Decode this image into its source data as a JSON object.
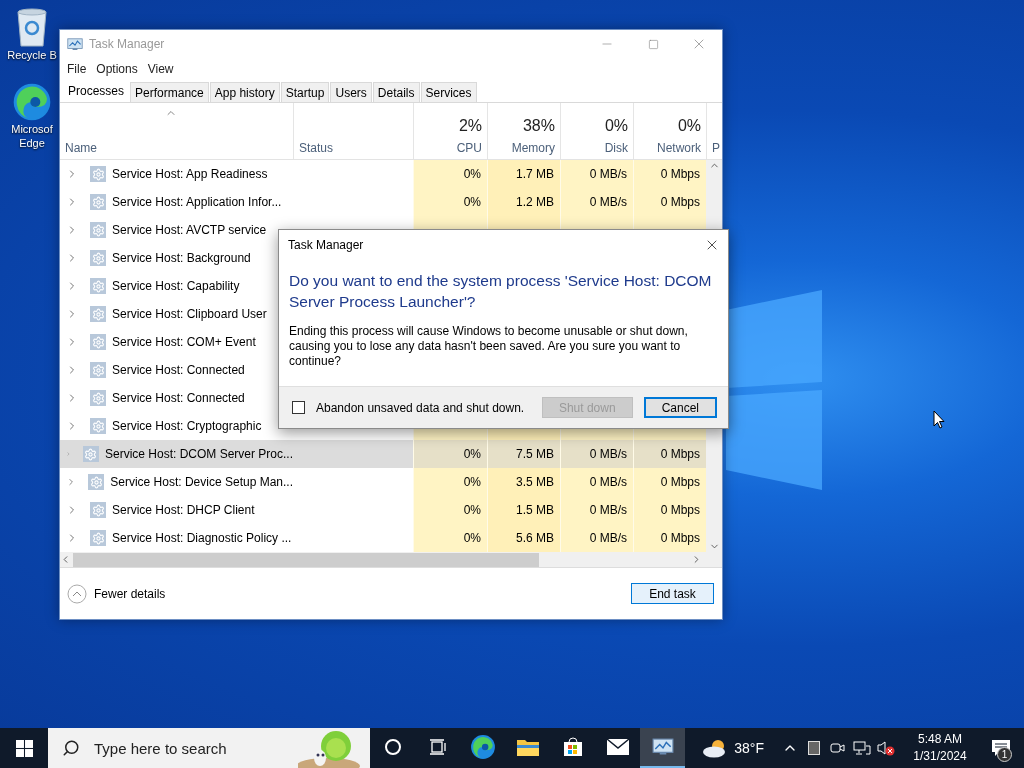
{
  "desktop": {
    "icons": [
      {
        "kind": "recycle",
        "lines": [
          "Recycle B"
        ]
      },
      {
        "kind": "edge",
        "lines": [
          "Microsof",
          "Edge"
        ]
      }
    ]
  },
  "task_manager": {
    "title": "Task Manager",
    "menu": [
      "File",
      "Options",
      "View"
    ],
    "tabs": [
      {
        "label": "Processes",
        "selected": true
      },
      {
        "label": "Performance",
        "selected": false
      },
      {
        "label": "App history",
        "selected": false
      },
      {
        "label": "Startup",
        "selected": false
      },
      {
        "label": "Users",
        "selected": false
      },
      {
        "label": "Details",
        "selected": false
      },
      {
        "label": "Services",
        "selected": false
      }
    ],
    "columns": [
      {
        "label": "Name"
      },
      {
        "label": "Status"
      },
      {
        "percent": "2%",
        "label": "CPU"
      },
      {
        "percent": "38%",
        "label": "Memory"
      },
      {
        "percent": "0%",
        "label": "Disk"
      },
      {
        "percent": "0%",
        "label": "Network"
      },
      {
        "label": "P"
      }
    ],
    "rows": [
      {
        "name": "Service Host: App Readiness",
        "selected": false,
        "cpu": "0%",
        "memory": "1.7 MB",
        "disk": "0 MB/s",
        "network": "0 Mbps"
      },
      {
        "name": "Service Host: Application Infor...",
        "selected": false,
        "cpu": "0%",
        "memory": "1.2 MB",
        "disk": "0 MB/s",
        "network": "0 Mbps"
      },
      {
        "name": "Service Host: AVCTP service",
        "selected": false
      },
      {
        "name": "Service Host: Background",
        "selected": false
      },
      {
        "name": "Service Host: Capability",
        "selected": false
      },
      {
        "name": "Service Host: Clipboard User",
        "selected": false
      },
      {
        "name": "Service Host: COM+ Event",
        "selected": false
      },
      {
        "name": "Service Host: Connected",
        "selected": false
      },
      {
        "name": "Service Host: Connected",
        "selected": false
      },
      {
        "name": "Service Host: Cryptographic",
        "selected": false
      },
      {
        "name": "Service Host: DCOM Server Proc...",
        "selected": true,
        "cpu": "0%",
        "memory": "7.5 MB",
        "disk": "0 MB/s",
        "network": "0 Mbps"
      },
      {
        "name": "Service Host: Device Setup Man...",
        "selected": false,
        "cpu": "0%",
        "memory": "3.5 MB",
        "disk": "0 MB/s",
        "network": "0 Mbps"
      },
      {
        "name": "Service Host: DHCP Client",
        "selected": false,
        "cpu": "0%",
        "memory": "1.5 MB",
        "disk": "0 MB/s",
        "network": "0 Mbps"
      },
      {
        "name": "Service Host: Diagnostic Policy ...",
        "selected": false,
        "cpu": "0%",
        "memory": "5.6 MB",
        "disk": "0 MB/s",
        "network": "0 Mbps"
      }
    ],
    "fewer_details": "Fewer details",
    "end_task": "End task"
  },
  "dialog": {
    "title": "Task Manager",
    "heading": "Do you want to end the system process 'Service Host: DCOM Server Process Launcher'?",
    "body": "Ending this process will cause Windows to become unusable or shut down, causing you to lose any data hasn't been saved. Are you sure you want to continue?",
    "checkbox": {
      "label": "Abandon unsaved data and shut down.",
      "checked": false
    },
    "buttons": [
      {
        "label": "Shut down",
        "disabled": true,
        "default": false
      },
      {
        "label": "Cancel",
        "disabled": false,
        "default": true
      }
    ]
  },
  "taskbar": {
    "search_placeholder": "Type here to search",
    "apps": [
      {
        "kind": "cortana",
        "active": false
      },
      {
        "kind": "taskview",
        "active": false
      },
      {
        "kind": "edge",
        "active": false
      },
      {
        "kind": "explorer",
        "active": false
      },
      {
        "kind": "store",
        "active": false
      },
      {
        "kind": "mail",
        "active": false
      },
      {
        "kind": "taskmanager",
        "active": true
      }
    ],
    "weather": "38°F",
    "time": "5:48 AM",
    "date": "1/31/2024",
    "notification_count": "1"
  }
}
